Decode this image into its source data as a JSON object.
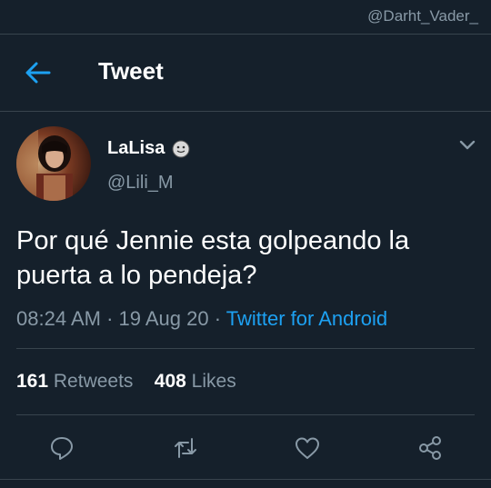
{
  "watermark": "@Darht_Vader_",
  "header": {
    "title": "Tweet",
    "back_icon": "arrow-left-icon"
  },
  "tweet": {
    "author_name": "LaLisa",
    "author_emoji": "smiling-face-icon",
    "handle": "@Lili_M",
    "text": "Por qué Jennie esta golpeando la puerta a lo pendeja?",
    "time": "08:24 AM",
    "sep1": " · ",
    "date": "19 Aug 20",
    "sep2": " · ",
    "source": "Twitter for Android",
    "retweets_count": "161",
    "retweets_label": "Retweets",
    "likes_count": "408",
    "likes_label": "Likes"
  },
  "actions": [
    "reply-icon",
    "retweet-icon",
    "like-icon",
    "share-icon"
  ],
  "colors": {
    "background": "#15202b",
    "accent": "#1da1f2",
    "muted": "#8899a6",
    "divider": "#38444d"
  }
}
